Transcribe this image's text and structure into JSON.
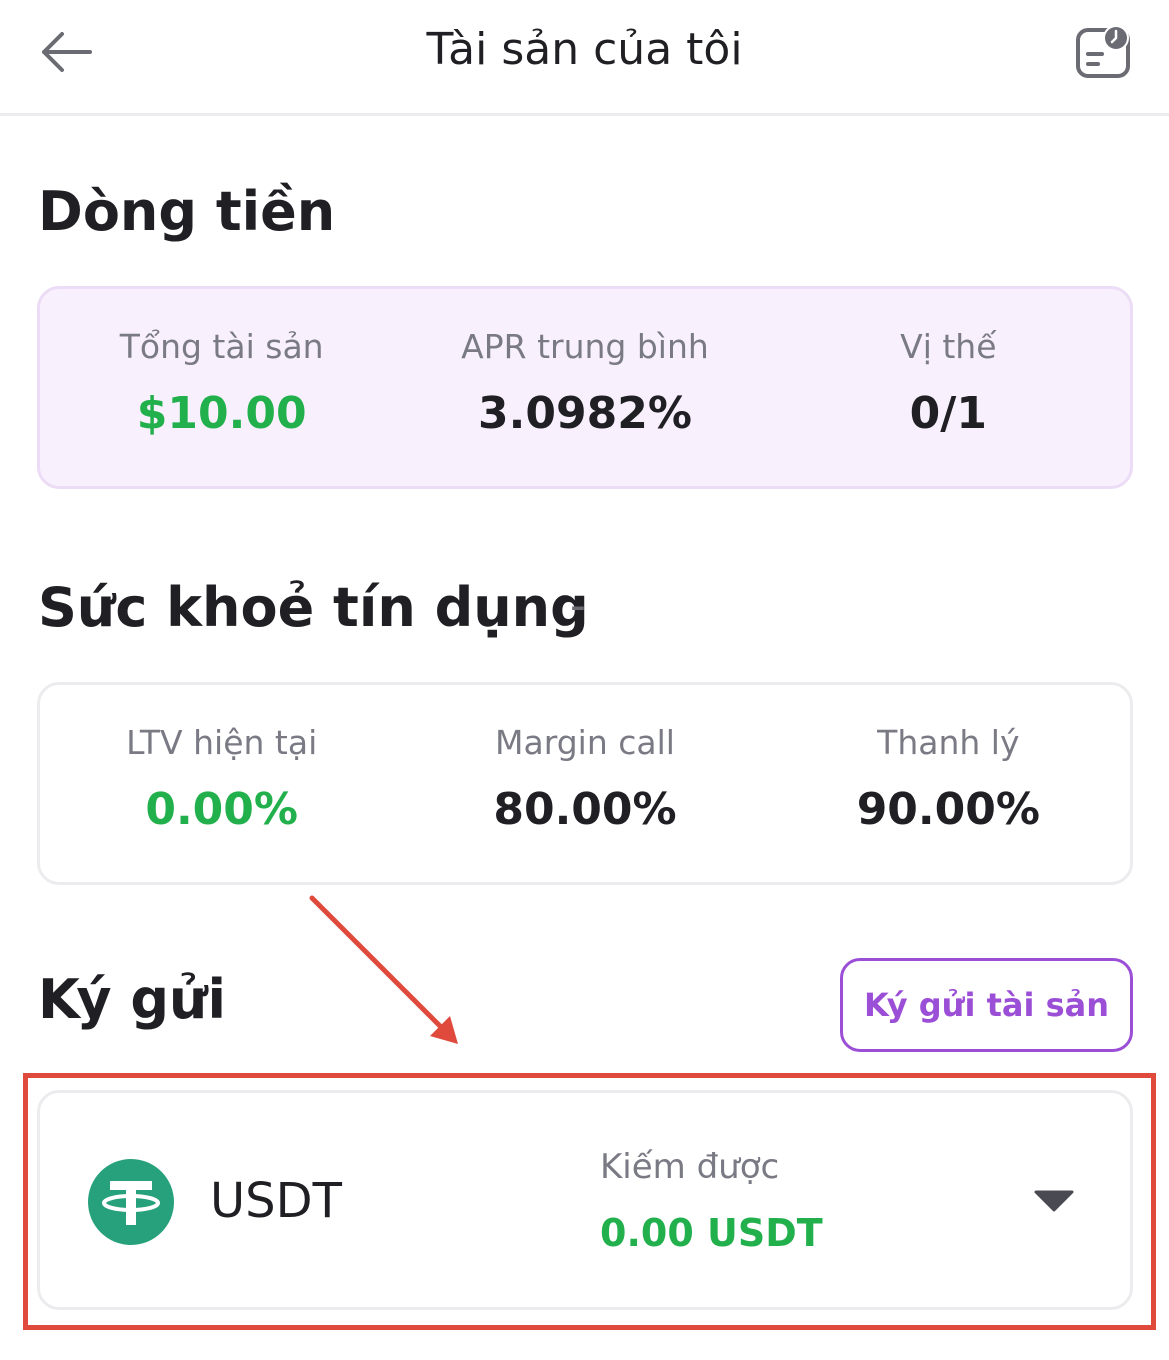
{
  "header": {
    "title": "Tài sản của tôi"
  },
  "cashflow": {
    "title": "Dòng tiền",
    "stats": [
      {
        "label": "Tổng tài sản",
        "value": "$10.00"
      },
      {
        "label": "APR trung bình",
        "value": "3.0982%"
      },
      {
        "label": "Vị thế",
        "value": "0/1"
      }
    ]
  },
  "credit_health": {
    "title": "Sức khoẻ tín dụng",
    "status": "-",
    "stats": [
      {
        "label": "LTV hiện tại",
        "value": "0.00%"
      },
      {
        "label": "Margin call",
        "value": "80.00%"
      },
      {
        "label": "Thanh lý",
        "value": "90.00%"
      }
    ]
  },
  "deposit": {
    "title": "Ký gửi",
    "button_label": "Ký gửi tài sản",
    "assets": [
      {
        "symbol": "USDT",
        "icon": "tether-icon",
        "earned_label": "Kiếm được",
        "earned_value": "0.00 USDT"
      }
    ]
  },
  "colors": {
    "accent_purple": "#9b4fd6",
    "positive_green": "#22b04c",
    "annotation_red": "#e04a3c",
    "tether_green": "#26a17b"
  }
}
